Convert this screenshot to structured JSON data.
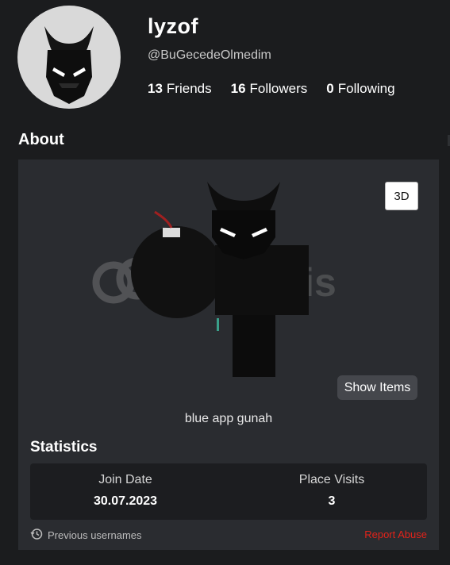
{
  "profile": {
    "display_name": "lyzof",
    "username": "@BuGecedeOlmedim",
    "friends_count": "13",
    "friends_label": "Friends",
    "followers_count": "16",
    "followers_label": "Followers",
    "following_count": "0",
    "following_label": "Following"
  },
  "about": {
    "title": "About",
    "btn_3d": "3D",
    "show_items": "Show Items",
    "blurb": "blue app gunah",
    "watermark": "itemsatis"
  },
  "statistics": {
    "title": "Statistics",
    "join_date_label": "Join Date",
    "join_date_value": "30.07.2023",
    "place_visits_label": "Place Visits",
    "place_visits_value": "3"
  },
  "footer": {
    "previous_usernames": "Previous usernames",
    "report_abuse": "Report Abuse"
  },
  "colors": {
    "background": "#1b1c1e",
    "card": "#2a2c30",
    "report": "#e2231a"
  }
}
